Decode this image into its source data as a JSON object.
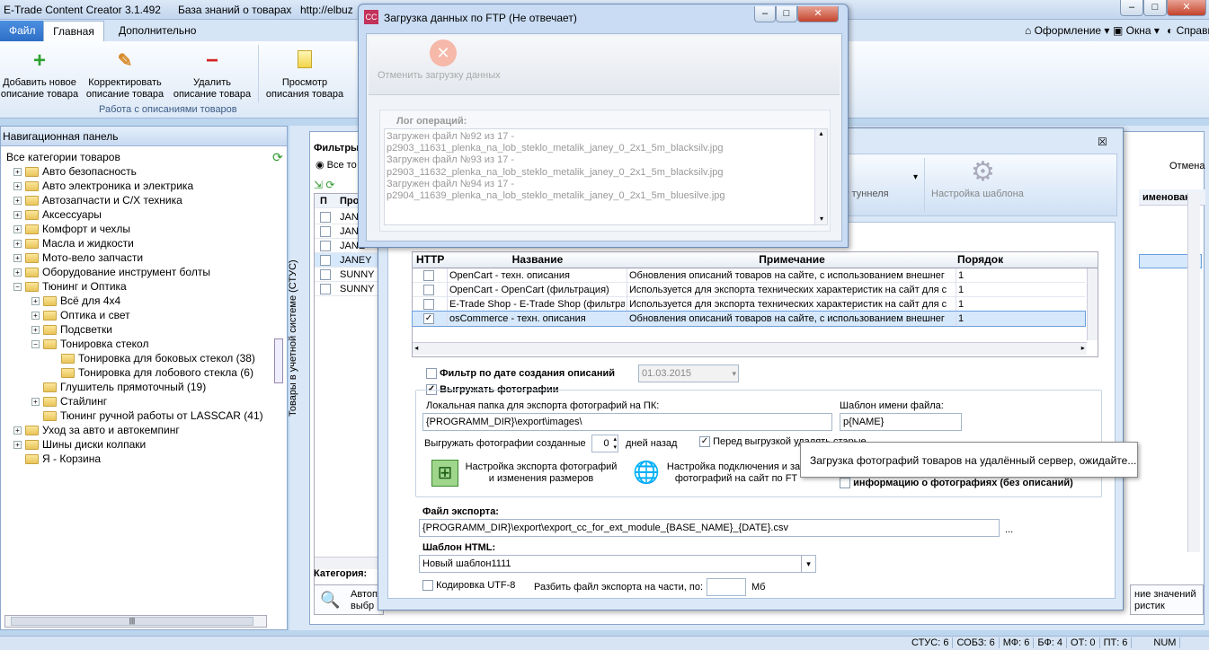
{
  "titlebar": {
    "app_title": "E-Trade Content Creator 3.1.492",
    "kb_title": "База знаний о товарах",
    "url": "http://elbuz"
  },
  "ribbon": {
    "tabs": [
      "Файл",
      "Главная",
      "Дополнительно"
    ],
    "right_menus": [
      "Оформление",
      "Окна",
      "Справка"
    ],
    "buttons": [
      {
        "line1": "Добавить новое",
        "line2": "описание товара"
      },
      {
        "line1": "Корректировать",
        "line2": "описание товара"
      },
      {
        "line1": "Удалить",
        "line2": "описание товара"
      },
      {
        "line1": "Просмотр",
        "line2": "описания товара"
      }
    ],
    "group_label": "Работа с описаниями товаров"
  },
  "nav": {
    "title": "Навигационная панель",
    "items": [
      {
        "label": "Все категории товаров",
        "level": 0,
        "exp": ""
      },
      {
        "label": "Авто безопасность",
        "level": 1,
        "exp": "+"
      },
      {
        "label": "Авто электроника и электрика",
        "level": 1,
        "exp": "+"
      },
      {
        "label": "Автозапчасти и С/Х техника",
        "level": 1,
        "exp": "+"
      },
      {
        "label": "Аксессуары",
        "level": 1,
        "exp": "+"
      },
      {
        "label": "Комфорт и чехлы",
        "level": 1,
        "exp": "+"
      },
      {
        "label": "Масла и жидкости",
        "level": 1,
        "exp": "+"
      },
      {
        "label": "Мото-вело запчасти",
        "level": 1,
        "exp": "+"
      },
      {
        "label": "Оборудование инструмент болты",
        "level": 1,
        "exp": "+"
      },
      {
        "label": "Тюнинг и Оптика",
        "level": 1,
        "exp": "−"
      },
      {
        "label": "Всё для 4х4",
        "level": 2,
        "exp": "+"
      },
      {
        "label": "Оптика и свет",
        "level": 2,
        "exp": "+"
      },
      {
        "label": "Подсветки",
        "level": 2,
        "exp": "+"
      },
      {
        "label": "Тонировка стекол",
        "level": 2,
        "exp": "−"
      },
      {
        "label": "Тонировка для боковых стекол (38)",
        "level": 3,
        "exp": ""
      },
      {
        "label": "Тонировка для лобового стекла (6)",
        "level": 3,
        "exp": ""
      },
      {
        "label": "Глушитель прямоточный (19)",
        "level": 2,
        "exp": ""
      },
      {
        "label": "Стайлинг",
        "level": 2,
        "exp": "+"
      },
      {
        "label": "Тюнинг ручной работы от LASSCAR (41)",
        "level": 2,
        "exp": ""
      },
      {
        "label": "Уход за авто и автокемпинг",
        "level": 1,
        "exp": "+"
      },
      {
        "label": "Шины диски колпаки",
        "level": 1,
        "exp": "+"
      },
      {
        "label": "Я - Корзина",
        "level": 1,
        "exp": ""
      }
    ]
  },
  "main": {
    "vertical_label": "Товары в учетной системе (СТУС)",
    "filter_label": "Фильтры",
    "filter_radio": "Все то",
    "grid_header": [
      "П",
      "Про"
    ],
    "grid_rows": [
      "JANE",
      "JANE",
      "JANE",
      "JANEY",
      "SUNNY",
      "SUNNY"
    ],
    "category_label": "Категория:",
    "bottom_btn": "Автопо выбр",
    "right_cancel": "Отмена",
    "right_header": "именовани",
    "right_bottom": "ние значений ристик"
  },
  "export_dialog": {
    "toolbar_tunnel": "TTP туннеля",
    "toolbar_template": "Настройка шаблона",
    "table_headers": [
      "HTTP",
      "Название",
      "Примечание",
      "Порядок"
    ],
    "table_rows": [
      {
        "checked": false,
        "name": "OpenCart - техн. описания",
        "note": "Обновления описаний товаров на сайте, с использованием внешнег",
        "order": "1"
      },
      {
        "checked": false,
        "name": "OpenCart - OpenCart (фильтрация)",
        "note": "Используется для экспорта технических характеристик на сайт для с",
        "order": "1"
      },
      {
        "checked": false,
        "name": "E-Trade Shop - E-Trade Shop (фильтра",
        "note": "Используется для экспорта технических характеристик на сайт для с",
        "order": "1"
      },
      {
        "checked": true,
        "name": "osCommerce - техн. описания",
        "note": "Обновления описаний товаров на сайте, с использованием внешнег",
        "order": "1"
      }
    ],
    "date_filter_label": "Фильтр по дате создания описаний",
    "date_value": "01.03.2015",
    "upload_photos_label": "Выгружать фотографии",
    "local_folder_label": "Локальная папка для экспорта фотографий на ПК:",
    "local_folder_value": "{PROGRAMM_DIR}\\export\\images\\",
    "file_template_label": "Шаблон имени файла:",
    "file_template_value": "p{NAME}",
    "created_label": "Выгружать фотографии созданные",
    "days_value": "0",
    "days_label": "дней назад",
    "delete_old_label": "Перед выгрузкой удалять старые",
    "photo_export_btn": "Настройка экспорта фотографий и изменения размеров",
    "ftp_conn_btn": "Настройка подключения и зап фотографий на сайт по FT",
    "photo_info_label": "информацию о фотографиях (без описаний)",
    "export_file_label": "Файл экспорта:",
    "export_file_value": "{PROGRAMM_DIR}\\export\\export_cc_for_ext_module_{BASE_NAME}_{DATE}.csv",
    "ellipsis": "...",
    "html_template_label": "Шаблон HTML:",
    "html_template_value": "Новый шаблон1111",
    "utf8_label": "Кодировка UTF-8",
    "split_label": "Разбить файл экспорта на части, по:",
    "mb_label": "Мб",
    "tooltip": "Загрузка фотографий товаров на удалённый сервер, ожидайте..."
  },
  "ftp_dialog": {
    "title": "Загрузка данных по FTP (Не отвечает)",
    "cancel_label": "Отменить загрузку данных",
    "log_label": "Лог операций:",
    "log_lines": [
      "Загружен файл №92 из 17 -",
      "p2903_11631_plenka_na_lob_steklo_metalik_janey_0_2x1_5m_blacksilv.jpg",
      "Загружен файл №93 из 17 -",
      "p2903_11632_plenka_na_lob_steklo_metalik_janey_0_2x1_5m_blacksilv.jpg",
      "Загружен файл №94 из 17 -",
      "p2904_11639_plenka_na_lob_steklo_metalik_janey_0_2x1_5m_bluesilve.jpg"
    ]
  },
  "statusbar": [
    "СТУС: 6",
    "СОБЗ: 6",
    "МФ: 6",
    "БФ: 4",
    "ОТ: 0",
    "ПТ: 6",
    "NUM"
  ]
}
